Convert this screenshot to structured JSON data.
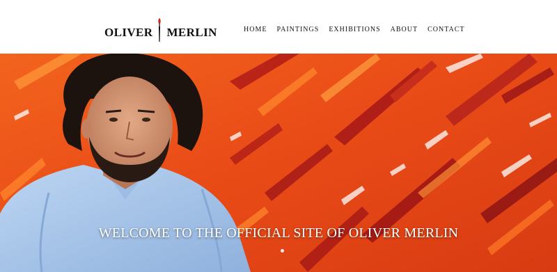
{
  "site": {
    "logo_left": "OLIVER",
    "logo_right": "MERLIN"
  },
  "nav": {
    "items": [
      {
        "label": "HOME"
      },
      {
        "label": "PAINTINGS"
      },
      {
        "label": "EXHIBITIONS"
      },
      {
        "label": "ABOUT"
      },
      {
        "label": "CONTACT"
      }
    ]
  },
  "hero": {
    "headline": "WELCOME TO THE OFFICIAL SITE OF OLIVER MERLIN",
    "slide_count": 1,
    "active_slide": 1
  },
  "colors": {
    "painting_orange": "#e8501c",
    "painting_red": "#b8201a",
    "shirt_blue": "#a9c7ea",
    "hair_dark": "#1c120e"
  },
  "icons": {
    "logo_mark": "paintbrush-icon"
  }
}
